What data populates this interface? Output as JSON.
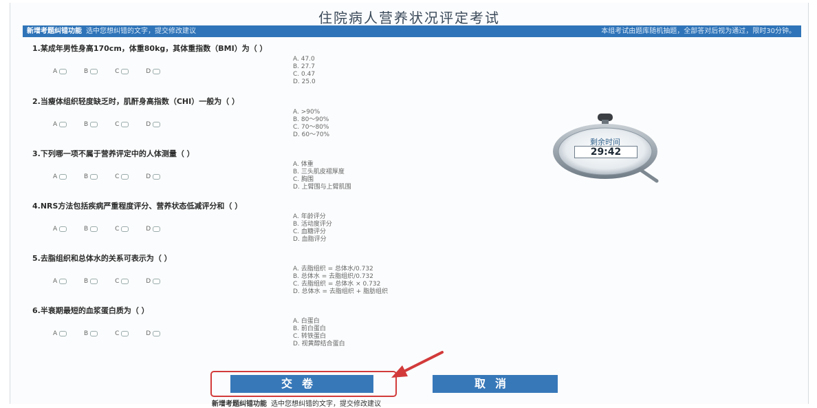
{
  "title": "住院病人营养状况评定考试",
  "info_bar": {
    "feature": "新增考题纠错功能",
    "hint": "选中您想纠错的文字，提交修改建议",
    "right": "本组考试由题库随机抽题，全部答对后视为通过，限时30分钟。"
  },
  "questions": [
    {
      "title": "1.某成年男性身高170cm，体重80kg，其体重指数（BMI）为（ ）",
      "options": [
        "A. 47.0",
        "B. 27.7",
        "C. 0.47",
        "D. 25.0"
      ]
    },
    {
      "title": "2.当瘦体组织轻度缺乏时，肌酐身高指数（CHI）一般为（ ）",
      "options": [
        "A. >90%",
        "B. 80～90%",
        "C. 70～80%",
        "D. 60～70%"
      ]
    },
    {
      "title": "3.下列哪一项不属于营养评定中的人体测量（ ）",
      "options": [
        "A. 体重",
        "B. 三头肌皮褶厚度",
        "C. 胸围",
        "D. 上臂围与上臂肌围"
      ]
    },
    {
      "title": "4.NRS方法包括疾病严重程度评分、营养状态低减评分和（ ）",
      "options": [
        "A. 年龄评分",
        "B. 活动度评分",
        "C. 血糖评分",
        "D. 血脂评分"
      ]
    },
    {
      "title": "5.去脂组织和总体水的关系可表示为（ ）",
      "options": [
        "A. 去脂组织 = 总体水/0.732",
        "B. 总体水 = 去脂组织/0.732",
        "C. 去脂组织 = 总体水 × 0.732",
        "D. 总体水 = 去脂组织 + 脂肪组织"
      ]
    },
    {
      "title": "6.半衰期最短的血浆蛋白质为（ ）",
      "options": [
        "A. 白蛋白",
        "B. 前白蛋白",
        "C. 转铁蛋白",
        "D. 视黄醇结合蛋白"
      ]
    }
  ],
  "radio_labels": [
    "A",
    "B",
    "C",
    "D"
  ],
  "timer": {
    "label": "剩余时间",
    "value": "29:42"
  },
  "buttons": {
    "submit": "交卷",
    "cancel": "取消"
  },
  "bottom": {
    "feature": "新增考题纠错功能",
    "hint": "选中您想纠错的文字，提交修改建议"
  },
  "colors": {
    "accent": "#3778b9",
    "highlight": "#d23a3a"
  }
}
